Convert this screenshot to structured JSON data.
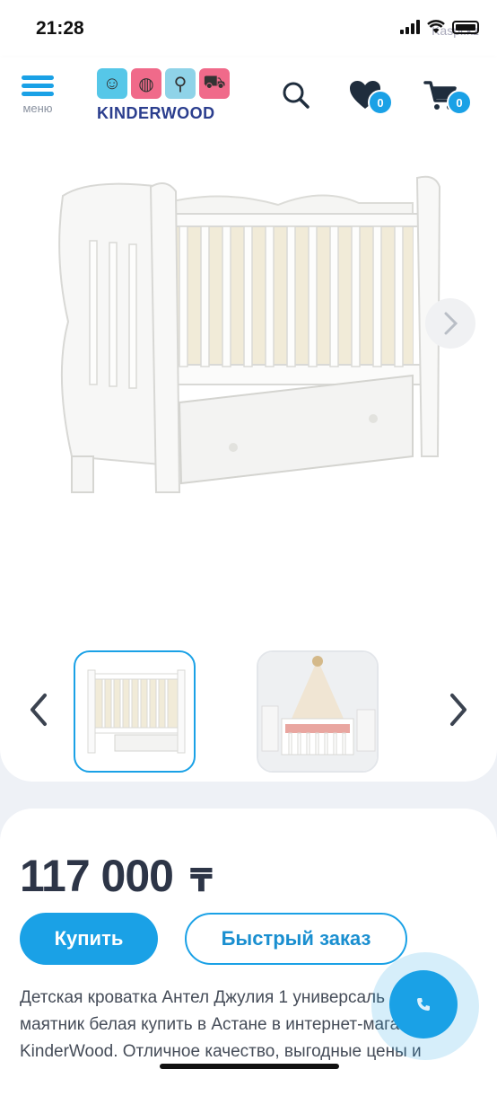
{
  "status_bar": {
    "time": "21:28",
    "watermark": "Kaspi.kz"
  },
  "header": {
    "menu_label": "меню",
    "logo_text": "KINDERWOOD",
    "wishlist_count": "0",
    "cart_count": "0",
    "accent_color": "#1aa1e6"
  },
  "gallery": {
    "main_image": "white-baby-crib-with-drawer",
    "thumbnails": [
      {
        "image": "white-crib-thumbnail",
        "active": true
      },
      {
        "image": "crib-in-room-with-canopy-thumbnail",
        "active": false
      }
    ]
  },
  "product": {
    "price": "117 000",
    "currency": "₸",
    "buy_label": "Купить",
    "quick_order_label": "Быстрый заказ",
    "description_lines": [
      "Детская кроватка Антел Джулия 1 универсаль",
      "маятник белая купить в Астане в интернет-магазине",
      "KinderWood. Отличное качество, выгодные цены и"
    ]
  }
}
